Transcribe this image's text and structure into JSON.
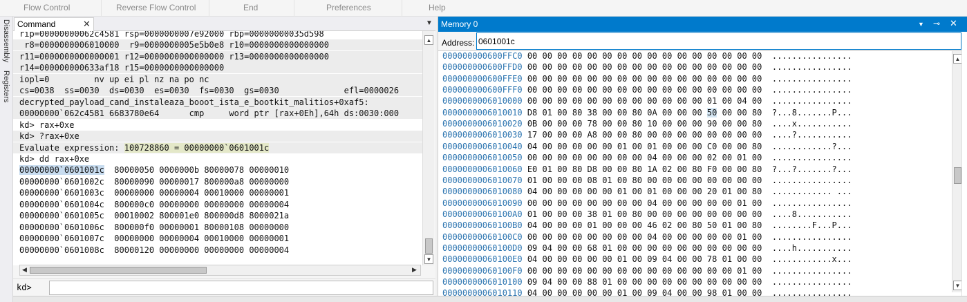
{
  "ribbon": {
    "items": [
      "Flow Control",
      "Reverse Flow Control",
      "End",
      "Preferences",
      "Help"
    ]
  },
  "side_tabs": [
    "Disassembly",
    "Registers"
  ],
  "command": {
    "tab_label": "Command",
    "prompt": "kd>",
    "input_value": "",
    "lines": [
      {
        "text": "rip=00000000062c4581 rsp=0000000007e92000 rbp=00000000035d598",
        "style": "normal"
      },
      {
        "text": " r8=0000000006010000  r9=0000000005e5b0e8 r10=0000000000000000",
        "style": "gray"
      },
      {
        "text": "r11=0000000000000001 r12=0000000000000000 r13=0000000000000000",
        "style": "gray"
      },
      {
        "text": "r14=000000000633af18 r15=0000000000000000",
        "style": "gray"
      },
      {
        "text": "iopl=0         nv up ei pl nz na po nc",
        "style": "gray"
      },
      {
        "text": "cs=0038  ss=0030  ds=0030  es=0030  fs=0030  gs=0030             efl=0000026",
        "style": "gray"
      },
      {
        "text": "decrypted_payload_cand_instaleaza_booot_ista_e_bootkit_malitios+0xaf5:",
        "style": "gray"
      },
      {
        "text": "00000000`062c4581 6683780e64      cmp     word ptr [rax+0Eh],64h ds:0030:000",
        "style": "gray"
      },
      {
        "text": "kd> rax+0xe",
        "style": "normal"
      },
      {
        "text": "kd> ?rax+0xe",
        "style": "gray"
      },
      {
        "text": "Evaluate expression: ",
        "style": "gray",
        "hl": "100728860 = 00000000`0601001c"
      },
      {
        "text": "kd> dd rax+0xe",
        "style": "normal"
      },
      {
        "text": "`0601001c  80000050 0000000b 80000078 00000010",
        "style": "normal",
        "sel": "00000000`0601001c"
      },
      {
        "text": "00000000`0601002c  80000090 00000017 800000a8 00000000",
        "style": "normal"
      },
      {
        "text": "00000000`0601003c  00000000 00000004 00010000 00000001",
        "style": "normal"
      },
      {
        "text": "00000000`0601004c  800000c0 00000000 00000000 00000004",
        "style": "normal"
      },
      {
        "text": "00000000`0601005c  00010002 800001e0 800000d8 8000021a",
        "style": "normal"
      },
      {
        "text": "00000000`0601006c  800000f0 00000001 80000108 00000000",
        "style": "normal"
      },
      {
        "text": "00000000`0601007c  00000000 00000004 00010000 00000001",
        "style": "normal"
      },
      {
        "text": "00000000`0601008c  80000120 00000000 00000000 00000004",
        "style": "normal"
      }
    ]
  },
  "memory": {
    "title": "Memory 0",
    "address_label": "Address:",
    "address_value": "0601001c",
    "rows": [
      {
        "addr": "000000000600FFC0",
        "bytes": "00 00 00 00 00 00 00 00 00 00 00 00 00 00 00 00",
        "ascii": "................"
      },
      {
        "addr": "000000000600FFD0",
        "bytes": "00 00 00 00 00 00 00 00 00 00 00 00 00 00 00 00",
        "ascii": "................"
      },
      {
        "addr": "000000000600FFE0",
        "bytes": "00 00 00 00 00 00 00 00 00 00 00 00 00 00 00 00",
        "ascii": "................"
      },
      {
        "addr": "000000000600FFF0",
        "bytes": "00 00 00 00 00 00 00 00 00 00 00 00 00 00 00 00",
        "ascii": "................"
      },
      {
        "addr": "0000000006010000",
        "bytes": "00 00 00 00 00 00 00 00 00 00 00 00 01 00 04 00",
        "ascii": "................"
      },
      {
        "addr": "0000000006010010",
        "bytes": "D8 01 00 80 38 00 00 80 0A 00 00 00 ",
        "hl": "50",
        "bytes2": " 00 00 80",
        "ascii": "?...8.......P..."
      },
      {
        "addr": "0000000006010020",
        "bytes": "0B 00 00 00 78 00 00 80 10 00 00 00 90 00 00 80",
        "ascii": "....x..........."
      },
      {
        "addr": "0000000006010030",
        "bytes": "17 00 00 00 A8 00 00 80 00 00 00 00 00 00 00 00",
        "ascii": "....?..........."
      },
      {
        "addr": "0000000006010040",
        "bytes": "04 00 00 00 00 00 01 00 01 00 00 00 C0 00 00 80",
        "ascii": "............?..."
      },
      {
        "addr": "0000000006010050",
        "bytes": "00 00 00 00 00 00 00 00 04 00 00 00 02 00 01 00",
        "ascii": "................"
      },
      {
        "addr": "0000000006010060",
        "bytes": "E0 01 00 80 D8 00 00 80 1A 02 00 80 F0 00 00 80",
        "ascii": "?...?.......?..."
      },
      {
        "addr": "0000000006010070",
        "bytes": "01 00 00 00 08 01 00 80 00 00 00 00 00 00 00 00",
        "ascii": "................"
      },
      {
        "addr": "0000000006010080",
        "bytes": "04 00 00 00 00 00 01 00 01 00 00 00 20 01 00 80",
        "ascii": "............ ..."
      },
      {
        "addr": "0000000006010090",
        "bytes": "00 00 00 00 00 00 00 00 04 00 00 00 00 00 01 00",
        "ascii": "................"
      },
      {
        "addr": "00000000060100A0",
        "bytes": "01 00 00 00 38 01 00 80 00 00 00 00 00 00 00 00",
        "ascii": "....8..........."
      },
      {
        "addr": "00000000060100B0",
        "bytes": "04 00 00 00 01 00 00 00 46 02 00 80 50 01 00 80",
        "ascii": "........F...P..."
      },
      {
        "addr": "00000000060100C0",
        "bytes": "00 00 00 00 00 00 00 00 04 00 00 00 00 00 01 00",
        "ascii": "................"
      },
      {
        "addr": "00000000060100D0",
        "bytes": "09 04 00 00 68 01 00 00 00 00 00 00 00 00 00 00",
        "ascii": "....h..........."
      },
      {
        "addr": "00000000060100E0",
        "bytes": "04 00 00 00 00 00 01 00 09 04 00 00 78 01 00 00",
        "ascii": "............x..."
      },
      {
        "addr": "00000000060100F0",
        "bytes": "00 00 00 00 00 00 00 00 00 00 00 00 00 00 01 00",
        "ascii": "................"
      },
      {
        "addr": "0000000006010100",
        "bytes": "09 04 00 00 88 01 00 00 00 00 00 00 00 00 00 00",
        "ascii": "................"
      },
      {
        "addr": "0000000006010110",
        "bytes": "04 00 00 00 00 00 01 00 09 04 00 00 98 01 00 00",
        "ascii": "................"
      }
    ]
  },
  "colors": {
    "accent": "#007acc",
    "address": "#2b74b0"
  }
}
